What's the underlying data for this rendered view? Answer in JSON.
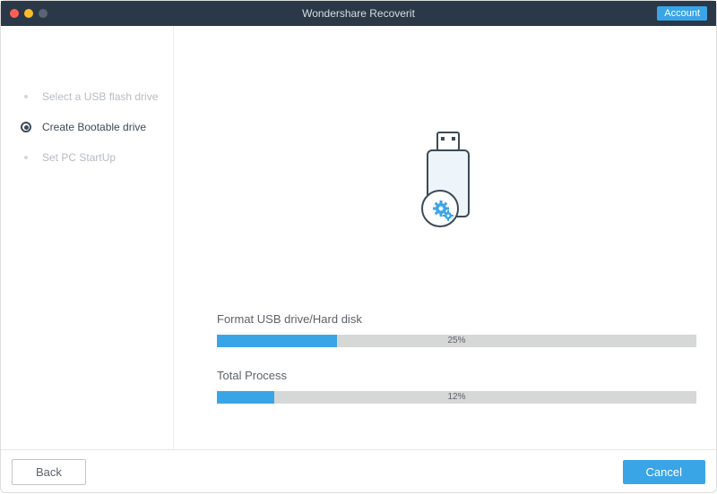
{
  "titlebar": {
    "title": "Wondershare Recoverit",
    "account_label": "Account"
  },
  "sidebar": {
    "items": [
      {
        "label": "Select a USB flash drive",
        "active": false
      },
      {
        "label": "Create Bootable drive",
        "active": true
      },
      {
        "label": "Set PC StartUp",
        "active": false
      }
    ]
  },
  "main": {
    "progress1": {
      "label": "Format USB drive/Hard disk",
      "percent": 25,
      "percent_text": "25%"
    },
    "progress2": {
      "label": "Total Process",
      "percent": 12,
      "percent_text": "12%"
    }
  },
  "footer": {
    "back_label": "Back",
    "cancel_label": "Cancel"
  }
}
